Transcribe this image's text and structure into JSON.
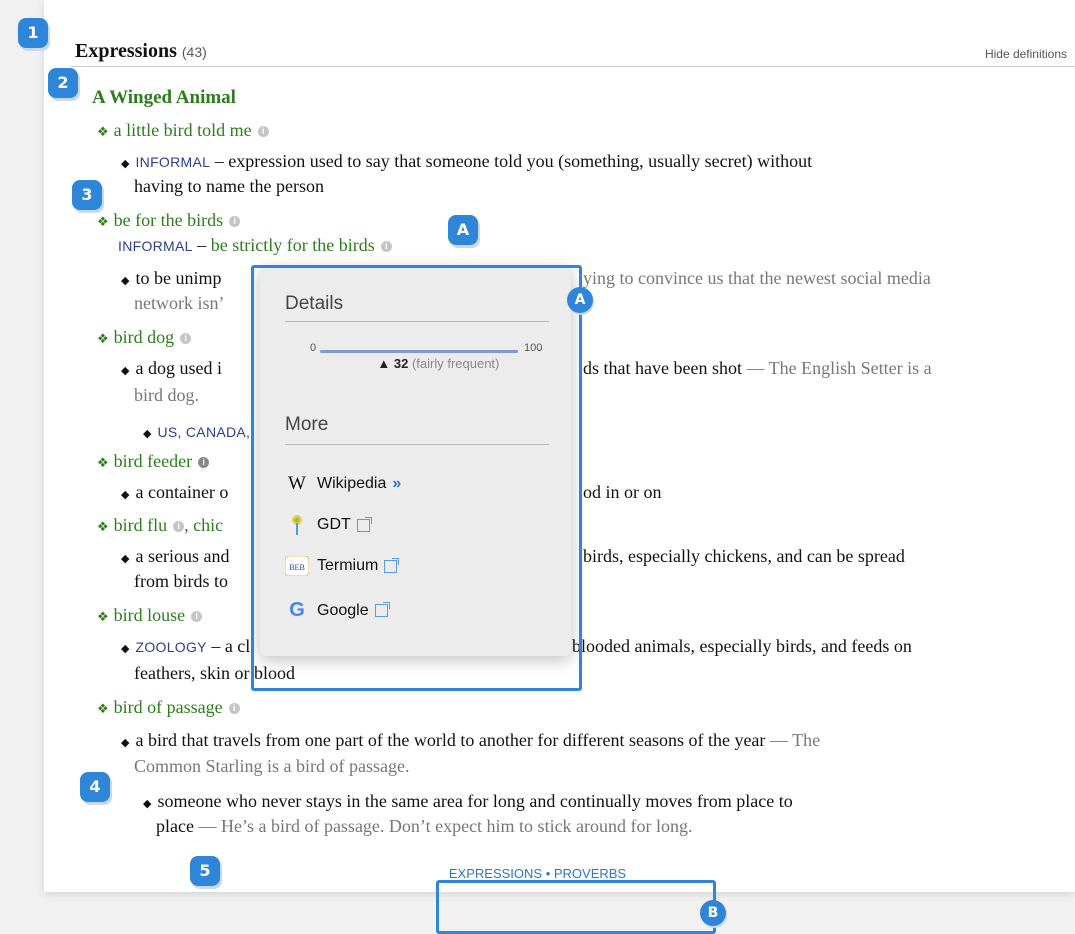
{
  "header": {
    "title": "Expressions",
    "count": "(43)",
    "hide_label": "Hide definitions"
  },
  "category": "A Winged Animal",
  "entries": {
    "e1": {
      "term": "a little bird told me"
    },
    "e1d": {
      "tag": "INFORMAL",
      "text": " – expression used to say that someone told you (something, usually secret) without",
      "text2": "having to name the person"
    },
    "e2": {
      "term": "be for the birds"
    },
    "e2v": {
      "tag": "INFORMAL",
      "dash": " – ",
      "term": "be strictly for the birds"
    },
    "e2d": {
      "text": "to be unimp",
      "text_right": "ying to convince us that the newest social media",
      "text2": "network isn’"
    },
    "e3": {
      "term": "bird dog"
    },
    "e3d": {
      "text": "a dog used i",
      "text_right": "ds that have been shot",
      "example": " — The English Setter is a",
      "text2": "bird dog."
    },
    "e3r": {
      "tag": "US, CANADA,"
    },
    "e4": {
      "term": "bird feeder"
    },
    "e4d": {
      "text": "a container o",
      "text_right": "od in or on"
    },
    "e5": {
      "term": "bird flu",
      "term2": ", chic"
    },
    "e5d": {
      "text": "a serious and",
      "text_right": "birds, especially chickens, and can be spread",
      "text2": "from birds to"
    },
    "e6": {
      "term": "bird louse"
    },
    "e6d": {
      "tag": "ZOOLOGY",
      "text": " – a cl",
      "text_right": "blooded animals, especially birds, and feeds on",
      "text2": "feathers, skin or blood"
    },
    "e7": {
      "term": "bird of passage"
    },
    "e7d1": {
      "text": "a bird that travels from one part of the world to another for different seasons of the year",
      "example": " — The",
      "text2": "Common Starling is a bird of passage."
    },
    "e7d2": {
      "text": "someone who never stays in the same area for long and continually moves from place to",
      "text2": "place",
      "example": " — He’s a bird of passage. Don’t expect him to stick around for long."
    }
  },
  "popup": {
    "details_heading": "Details",
    "scale_min": "0",
    "scale_max": "100",
    "frequency_value": 32,
    "frequency_label": "32",
    "frequency_desc": "(fairly frequent)",
    "more_heading": "More",
    "links": [
      {
        "label": "Wikipedia",
        "icon": "wikipedia-icon"
      },
      {
        "label": "GDT",
        "icon": "gdt-icon"
      },
      {
        "label": "Termium",
        "icon": "termium-icon"
      },
      {
        "label": "Google",
        "icon": "google-icon"
      }
    ]
  },
  "footer": {
    "expressions": "EXPRESSIONS",
    "sep": " • ",
    "proverbs": "PROVERBS"
  },
  "callouts": {
    "c1": "1",
    "c2": "2",
    "c3": "3",
    "c4": "4",
    "c5": "5",
    "ca1": "A",
    "ca2": "A",
    "cb": "B"
  },
  "colors": {
    "accent": "#2f86d8",
    "term_green": "#2e7d1c",
    "tag_blue": "#2c3f8c",
    "link_blue": "#2b74c7"
  }
}
